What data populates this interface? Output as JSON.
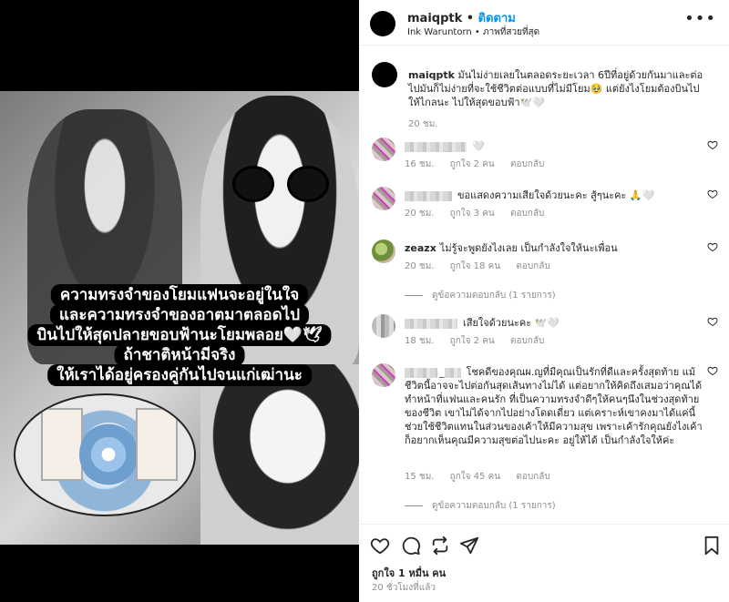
{
  "media": {
    "caption_lines": [
      "ความทรงจำของโยมแฟนจะอยู่ในใจ",
      "และความทรงจำของอาตมาตลอดไป",
      "บินไปให้สุดปลายขอบฟ้านะโยมพลอย🤍🕊",
      "ถ้าชาติหน้ามีจริง",
      "ให้เราได้อยู่ครองคู่กันไปจนแก่เฒ่านะ"
    ]
  },
  "header": {
    "username": "maiqptk",
    "follow_label": "ติดตาม",
    "subtitle": "Ink Waruntorn • ภาพที่สวยที่สุด",
    "more_label": "•••"
  },
  "caption": {
    "username": "maiqptk",
    "text": "มันไม่ง่ายเลยในตลอดระยะเวลา 6ปีที่อยู่ด้วยกันมาและต่อไปมันก็ไม่ง่ายที่จะใช้ชีวิตต่อแบบที่ไม่มีโยม🥹 แต่ยังไงโยมต้องบินไปให้ไกลนะ ไปให้สุดขอบฟ้า🕊️🤍",
    "time": "20 ชม."
  },
  "comments": [
    {
      "username": "",
      "text": "🤍",
      "time": "16 ชม.",
      "likes": "ถูกใจ 2 คน",
      "reply": "ตอบกลับ",
      "avatar": "pink"
    },
    {
      "username": "",
      "text": "ขอแสดงความเสียใจด้วยนะคะ สู้ๆนะคะ 🙏🤍",
      "time": "20 ชม.",
      "likes": "ถูกใจ 3 คน",
      "reply": "ตอบกลับ",
      "avatar": "pink"
    },
    {
      "username": "zeazx",
      "text": "ไม่รู้จะพูดยังไงเลย เป็นกำลังใจให้นะเพื่อน",
      "time": "20 ชม.",
      "likes": "ถูกใจ 18 คน",
      "reply": "ตอบกลับ",
      "avatar": "green",
      "view_replies": "ดูข้อความตอบกลับ (1 รายการ)"
    },
    {
      "username": "",
      "text": "เสียใจด้วยนะคะ 🕊️🤍",
      "time": "18 ชม.",
      "likes": "ถูกใจ 2 คน",
      "reply": "ตอบกลับ",
      "avatar": "gray"
    },
    {
      "username": "_",
      "text": "โชคดีของคุณผ.ญที่มีคุณเป็นรักที่ดีและครั้งสุดท้าย แม้ชีวิตนี้อาจจะไปต่อกันสุดเส้นทางไม่ได้ แต่อยากให้คิดถึงเสมอว่าคุณได้ทำหน้าที่แฟนและคนรัก ที่เป็นความทรงจำดีๆให้คนๆนึงในช่วงสุดท้ายของชีวิต เขาไม่ได้จากไปอย่างโดดเดี่ยว แต่เคราะห์เขาคงมาได้แค่นี้ ช่วยใช้ชีวิตแทนในส่วนของเค้าให้มีความสุข เพราะเค้ารักคุณยังไงเค้าก็อยากเห็นคุณมีความสุขต่อไปนะคะ อยู่ให้ได้ เป็นกำลังใจให้ค่ะ",
      "time": "15 ชม.",
      "likes": "ถูกใจ 45 คน",
      "reply": "ตอบกลับ",
      "avatar": "pink",
      "view_replies": "ดูข้อความตอบกลับ (1 รายการ)"
    }
  ],
  "footer": {
    "likes": "ถูกใจ 1 หมื่น คน",
    "time_ago": "20 ชั่วโมงที่แล้ว"
  },
  "icons": {
    "actions": [
      "heart-icon",
      "comment-icon",
      "share-icon",
      "send-icon",
      "bookmark-icon"
    ]
  }
}
